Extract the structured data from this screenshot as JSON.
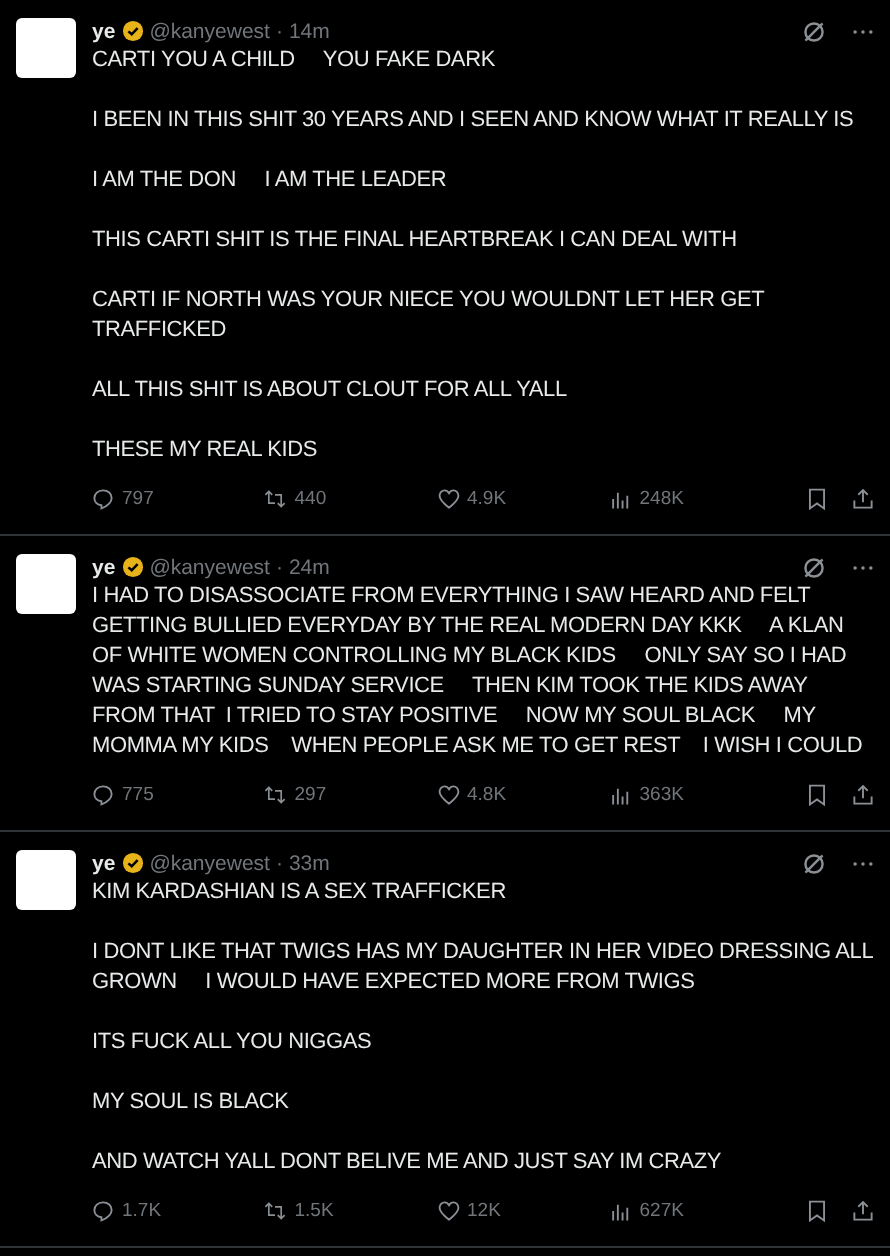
{
  "posts": [
    {
      "name": "ye",
      "verified": true,
      "handle": "@kanyewest",
      "separator": "·",
      "time": "14m",
      "paragraphs": [
        "CARTI YOU A CHILD     YOU FAKE DARK",
        "I BEEN IN THIS SHIT 30 YEARS AND I SEEN AND KNOW WHAT IT REALLY IS",
        "I AM THE DON     I AM THE LEADER",
        "THIS CARTI SHIT IS THE FINAL HEARTBREAK I CAN DEAL WITH",
        "CARTI IF NORTH WAS YOUR NIECE YOU WOULDNT LET HER GET TRAFFICKED",
        "ALL THIS SHIT IS ABOUT CLOUT FOR ALL YALL",
        "THESE MY REAL KIDS"
      ],
      "replies": "797",
      "reposts": "440",
      "likes": "4.9K",
      "views": "248K"
    },
    {
      "name": "ye",
      "verified": true,
      "handle": "@kanyewest",
      "separator": "·",
      "time": "24m",
      "paragraphs": [
        "I HAD TO DISASSOCIATE FROM EVERYTHING I SAW HEARD AND FELT GETTING BULLIED EVERYDAY BY THE REAL MODERN DAY KKK     A KLAN OF WHITE WOMEN CONTROLLING MY BLACK KIDS     ONLY SAY SO I HAD WAS STARTING SUNDAY SERVICE     THEN KIM TOOK THE KIDS AWAY FROM THAT  I TRIED TO STAY POSITIVE     NOW MY SOUL BLACK     MY MOMMA MY KIDS    WHEN PEOPLE ASK ME TO GET REST    I WISH I COULD"
      ],
      "replies": "775",
      "reposts": "297",
      "likes": "4.8K",
      "views": "363K"
    },
    {
      "name": "ye",
      "verified": true,
      "handle": "@kanyewest",
      "separator": "·",
      "time": "33m",
      "paragraphs": [
        "KIM KARDASHIAN IS A SEX TRAFFICKER",
        "I DONT LIKE THAT TWIGS HAS MY DAUGHTER IN HER VIDEO DRESSING ALL GROWN     I WOULD HAVE EXPECTED MORE FROM TWIGS",
        "ITS FUCK ALL YOU NIGGAS",
        "MY SOUL IS BLACK",
        "AND WATCH YALL DONT BELIVE ME AND JUST SAY IM CRAZY"
      ],
      "replies": "1.7K",
      "reposts": "1.5K",
      "likes": "12K",
      "views": "627K"
    }
  ]
}
